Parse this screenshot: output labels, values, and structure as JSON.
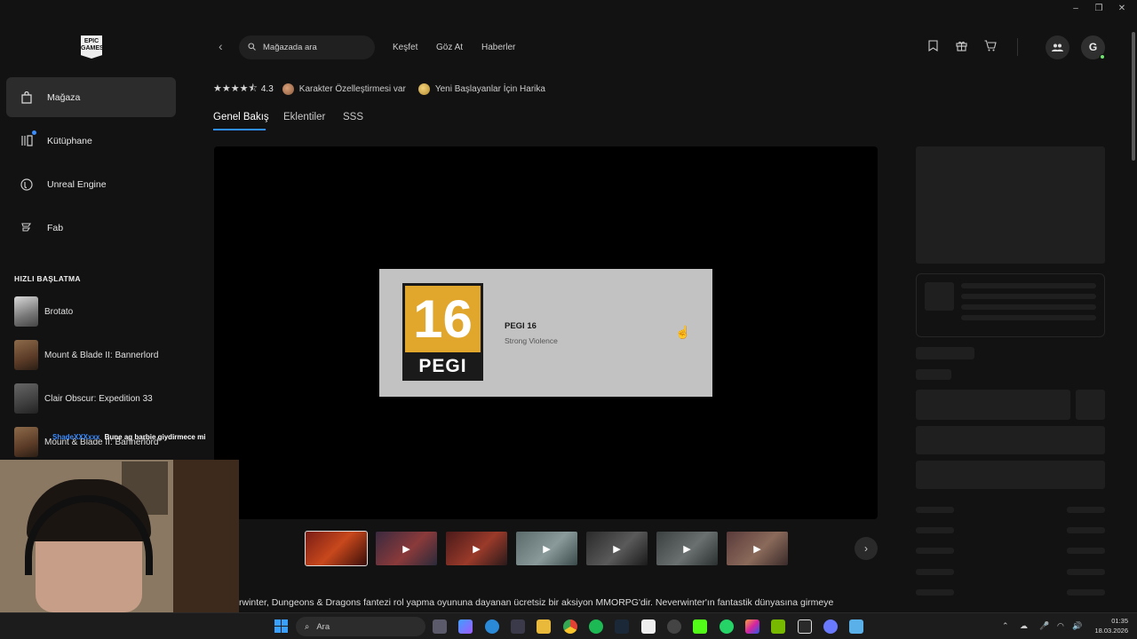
{
  "window": {
    "minimize": "–",
    "restore": "❐",
    "close": "✕"
  },
  "sidebar": {
    "logo_text": "EPIC GAMES",
    "nav": [
      {
        "label": "Mağaza",
        "icon": "store-bag-icon"
      },
      {
        "label": "Kütüphane",
        "icon": "library-icon"
      },
      {
        "label": "Unreal Engine",
        "icon": "unreal-engine-icon"
      },
      {
        "label": "Fab",
        "icon": "fab-icon"
      }
    ],
    "quick_title": "HIZLI BAŞLATMA",
    "quick_items": [
      {
        "label": "Brotato"
      },
      {
        "label": "Mount & Blade II: Bannerlord"
      },
      {
        "label": "Clair Obscur: Expedition 33"
      },
      {
        "label": "Mount & Blade II: Bannerlord"
      }
    ]
  },
  "topbar": {
    "back": "‹",
    "search_placeholder": "Mağazada ara",
    "nav": [
      "Keşfet",
      "Göz At",
      "Haberler"
    ],
    "avatar_initial": "G"
  },
  "product": {
    "stars": "★★★★⯪",
    "rating": "4.3",
    "tags": [
      "Karakter Özelleştirmesi var",
      "Yeni Başlayanlar İçin Harika"
    ],
    "tabs": [
      "Genel Bakış",
      "Eklentiler",
      "SSS"
    ],
    "pegi": {
      "number": "16",
      "brand": "PEGI",
      "title": "PEGI 16",
      "descriptor": "Strong Violence"
    },
    "thumbnail_count": 7,
    "next": "›",
    "description": "rwinter, Dungeons & Dragons fantezi rol yapma oyununa dayanan ücretsiz bir aksiyon MMORPG'dir. Neverwinter'ın fantastik dünyasına girmeye"
  },
  "stream_chat": {
    "user": "ShadeXXXxxx",
    "message": "Bune ag barbie giydirmece mi"
  },
  "taskbar": {
    "search_label": "Ara",
    "time": "01:35",
    "date": "18.03.2026"
  },
  "colors": {
    "accent": "#2f8fff",
    "pegi_orange": "#e1a72c",
    "active_nav_bg": "#2c2c2c"
  }
}
